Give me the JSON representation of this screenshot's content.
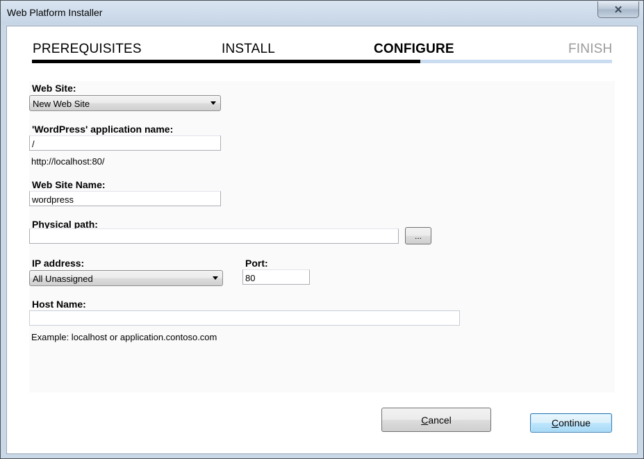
{
  "window": {
    "title": "Web Platform Installer",
    "close_symbol": "✕"
  },
  "steps": {
    "prerequisites": "PREREQUISITES",
    "install": "INSTALL",
    "configure": "CONFIGURE",
    "finish": "FINISH",
    "active": "CONFIGURE",
    "progress_fraction": 0.67
  },
  "form": {
    "web_site": {
      "label": "Web Site:",
      "value": "New Web Site"
    },
    "app_name": {
      "label": "'WordPress' application name:",
      "value": "/",
      "url_hint": "http://localhost:80/"
    },
    "web_site_name": {
      "label": "Web Site Name:",
      "value": "wordpress"
    },
    "physical_path": {
      "label": "Physical path:",
      "value": "",
      "browse_label": "..."
    },
    "ip_address": {
      "label": "IP address:",
      "value": "All Unassigned"
    },
    "port": {
      "label": "Port:",
      "value": "80"
    },
    "host_name": {
      "label": "Host Name:",
      "value": "",
      "example": "Example: localhost or application.contoso.com"
    }
  },
  "buttons": {
    "cancel": "Cancel",
    "continue": "Continue"
  },
  "colors": {
    "progress_done": "#000000",
    "progress_todo": "#c9dcf1",
    "finish_text": "#9a9a9a",
    "default_button_border": "#3c7fb1"
  }
}
